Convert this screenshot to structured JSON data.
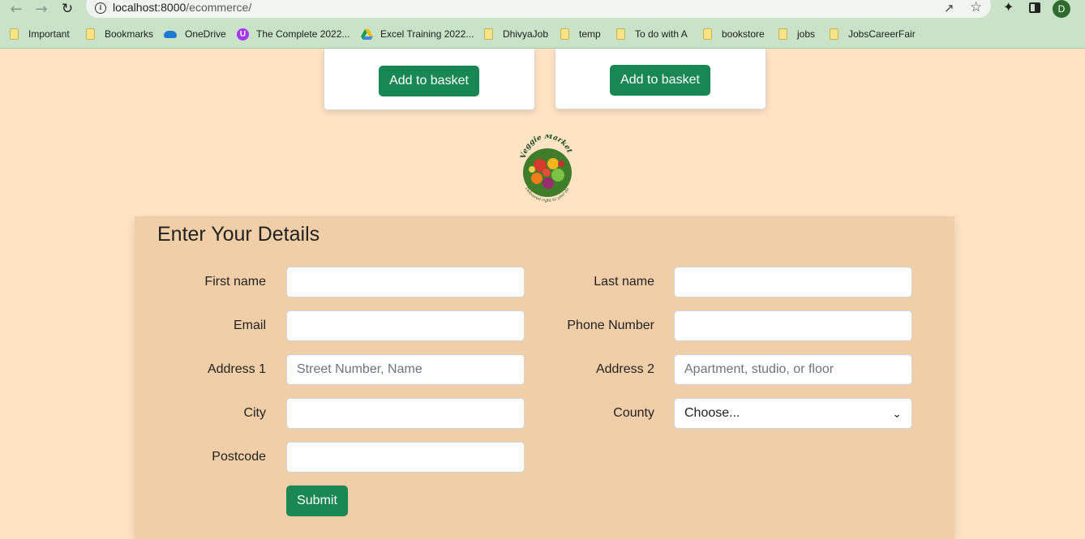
{
  "browser": {
    "url_host": "localhost:8000",
    "url_path": "/ecommerce/",
    "avatar_letter": "D",
    "bookmarks": [
      {
        "label": "Important",
        "icon": "folder-icon"
      },
      {
        "label": "Bookmarks",
        "icon": "folder-icon"
      },
      {
        "label": "OneDrive",
        "icon": "onedrive-icon"
      },
      {
        "label": "The Complete 2022...",
        "icon": "udemy-icon"
      },
      {
        "label": "Excel Training 2022...",
        "icon": "gdrive-icon"
      },
      {
        "label": "DhivyaJob",
        "icon": "folder-icon"
      },
      {
        "label": "temp",
        "icon": "folder-icon"
      },
      {
        "label": "To do with A",
        "icon": "folder-icon"
      },
      {
        "label": "bookstore",
        "icon": "folder-icon"
      },
      {
        "label": "jobs",
        "icon": "folder-icon"
      },
      {
        "label": "JobsCareerFair",
        "icon": "folder-icon"
      }
    ]
  },
  "products": {
    "add_to_basket_label": "Add to basket"
  },
  "logo": {
    "brand": "Veggie Market",
    "tagline": "Delivered right to your door"
  },
  "form": {
    "title": "Enter Your Details",
    "first_name_label": "First name",
    "last_name_label": "Last name",
    "email_label": "Email",
    "phone_label": "Phone Number",
    "address1_label": "Address 1",
    "address1_placeholder": "Street Number, Name",
    "address2_label": "Address 2",
    "address2_placeholder": "Apartment, studio, or floor",
    "city_label": "City",
    "county_label": "County",
    "county_selected": "Choose...",
    "postcode_label": "Postcode",
    "submit_label": "Submit"
  },
  "colors": {
    "page_bg": "#ffe4c4",
    "panel_bg": "#f0cfa8",
    "button_green": "#198754",
    "chrome_green": "#c9e3c9"
  }
}
